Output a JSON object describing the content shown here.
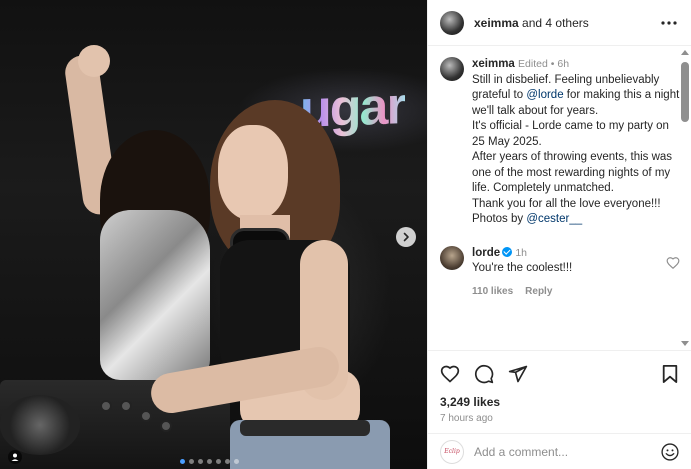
{
  "photo": {
    "sign_text": "ugar",
    "carousel": {
      "total": 7,
      "active_index": 0
    }
  },
  "header": {
    "username": "xeimma",
    "rest": " and 4 others"
  },
  "caption": {
    "username": "xeimma",
    "edited": "Edited",
    "separator": "•",
    "time": "6h",
    "line1_pre": "Still in disbelief. Feeling unbelievably grateful to ",
    "mention1": "@lorde",
    "line1_post": " for making this a night we'll talk about for years.",
    "para2": "It's official - Lorde came to my party on 25 May 2025.",
    "para3": "After years of throwing events, this was one of the most rewarding nights of my life. Completely unmatched.",
    "para4": "Thank you for all the love everyone!!!",
    "para5_pre": "Photos by ",
    "mention2": "@cester__"
  },
  "comment": {
    "username": "lorde",
    "time": "1h",
    "text": "You're the coolest!!!",
    "likes": "110 likes",
    "reply": "Reply"
  },
  "actions": {
    "likes": "3,249 likes",
    "time": "7 hours ago"
  },
  "add_comment": {
    "placeholder": "Add a comment...",
    "avatar_text": "Eclip"
  },
  "colors": {
    "link": "#00376b",
    "verified": "#0095f6",
    "muted": "#8e8e8e",
    "dot_active": "#4a9eff"
  }
}
